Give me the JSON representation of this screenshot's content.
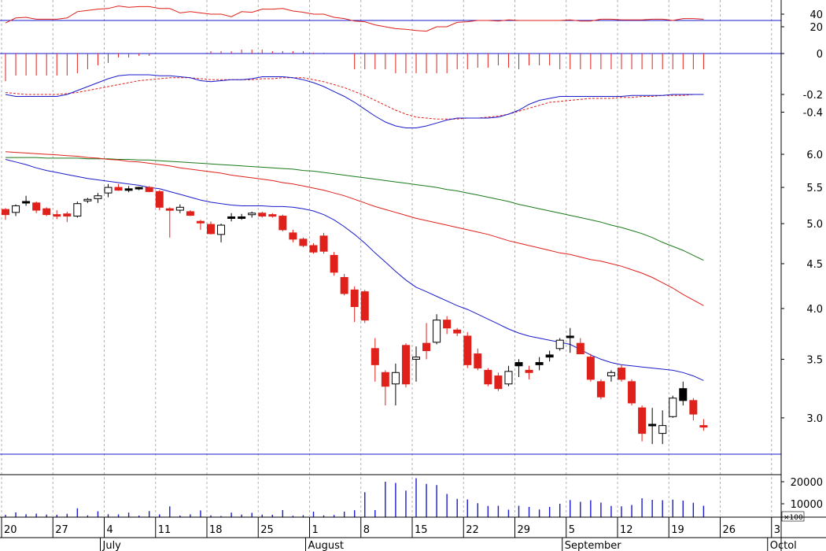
{
  "chart_data": {
    "type": "candlestick",
    "price_panel": {
      "y_axis": {
        "scale": "log",
        "range": [
          2.6,
          6.6
        ],
        "ticks": [
          "6.0",
          "5.5",
          "5.0",
          "4.5",
          "4.0",
          "3.5",
          "3.0"
        ]
      },
      "candles": [
        {
          "o": 5.12,
          "h": 5.21,
          "l": 5.05,
          "c": 5.19,
          "dir": "down"
        },
        {
          "o": 5.15,
          "h": 5.26,
          "l": 5.1,
          "c": 5.24,
          "dir": "up"
        },
        {
          "o": 5.3,
          "h": 5.38,
          "l": 5.24,
          "c": 5.28,
          "dir": "flat"
        },
        {
          "o": 5.28,
          "h": 5.3,
          "l": 5.14,
          "c": 5.18,
          "dir": "down"
        },
        {
          "o": 5.2,
          "h": 5.22,
          "l": 5.1,
          "c": 5.12,
          "dir": "down"
        },
        {
          "o": 5.12,
          "h": 5.18,
          "l": 5.06,
          "c": 5.11,
          "dir": "down"
        },
        {
          "o": 5.13,
          "h": 5.16,
          "l": 5.02,
          "c": 5.1,
          "dir": "down"
        },
        {
          "o": 5.1,
          "h": 5.3,
          "l": 5.08,
          "c": 5.27,
          "dir": "up"
        },
        {
          "o": 5.32,
          "h": 5.35,
          "l": 5.28,
          "c": 5.33,
          "dir": "up"
        },
        {
          "o": 5.34,
          "h": 5.42,
          "l": 5.28,
          "c": 5.38,
          "dir": "up"
        },
        {
          "o": 5.42,
          "h": 5.55,
          "l": 5.36,
          "c": 5.5,
          "dir": "up"
        },
        {
          "o": 5.5,
          "h": 5.55,
          "l": 5.45,
          "c": 5.46,
          "dir": "down"
        },
        {
          "o": 5.47,
          "h": 5.52,
          "l": 5.43,
          "c": 5.48,
          "dir": "flat"
        },
        {
          "o": 5.49,
          "h": 5.51,
          "l": 5.46,
          "c": 5.5,
          "dir": "flat"
        },
        {
          "o": 5.5,
          "h": 5.52,
          "l": 5.43,
          "c": 5.44,
          "dir": "down"
        },
        {
          "o": 5.44,
          "h": 5.46,
          "l": 5.18,
          "c": 5.22,
          "dir": "down"
        },
        {
          "o": 5.2,
          "h": 5.22,
          "l": 4.82,
          "c": 5.2,
          "dir": "down"
        },
        {
          "o": 5.18,
          "h": 5.26,
          "l": 5.14,
          "c": 5.22,
          "dir": "up"
        },
        {
          "o": 5.16,
          "h": 5.18,
          "l": 5.1,
          "c": 5.11,
          "dir": "down"
        },
        {
          "o": 5.02,
          "h": 5.05,
          "l": 4.92,
          "c": 5.03,
          "dir": "down"
        },
        {
          "o": 4.99,
          "h": 5.03,
          "l": 4.86,
          "c": 4.87,
          "dir": "down"
        },
        {
          "o": 4.86,
          "h": 5.0,
          "l": 4.76,
          "c": 4.98,
          "dir": "up"
        },
        {
          "o": 5.08,
          "h": 5.14,
          "l": 5.03,
          "c": 5.09,
          "dir": "flat"
        },
        {
          "o": 5.08,
          "h": 5.13,
          "l": 5.05,
          "c": 5.09,
          "dir": "flat"
        },
        {
          "o": 5.12,
          "h": 5.16,
          "l": 5.08,
          "c": 5.14,
          "dir": "up"
        },
        {
          "o": 5.14,
          "h": 5.16,
          "l": 5.08,
          "c": 5.1,
          "dir": "down"
        },
        {
          "o": 5.12,
          "h": 5.14,
          "l": 5.08,
          "c": 5.11,
          "dir": "down"
        },
        {
          "o": 5.1,
          "h": 5.12,
          "l": 4.9,
          "c": 4.92,
          "dir": "down"
        },
        {
          "o": 4.88,
          "h": 4.92,
          "l": 4.76,
          "c": 4.8,
          "dir": "down"
        },
        {
          "o": 4.8,
          "h": 4.82,
          "l": 4.7,
          "c": 4.72,
          "dir": "down"
        },
        {
          "o": 4.72,
          "h": 4.75,
          "l": 4.62,
          "c": 4.64,
          "dir": "down"
        },
        {
          "o": 4.84,
          "h": 4.88,
          "l": 4.62,
          "c": 4.65,
          "dir": "down"
        },
        {
          "o": 4.6,
          "h": 4.64,
          "l": 4.36,
          "c": 4.4,
          "dir": "down"
        },
        {
          "o": 4.34,
          "h": 4.38,
          "l": 4.14,
          "c": 4.16,
          "dir": "down"
        },
        {
          "o": 4.2,
          "h": 4.24,
          "l": 3.86,
          "c": 4.02,
          "dir": "down"
        },
        {
          "o": 4.18,
          "h": 4.2,
          "l": 3.85,
          "c": 3.88,
          "dir": "down"
        },
        {
          "o": 3.6,
          "h": 3.7,
          "l": 3.3,
          "c": 3.45,
          "dir": "down"
        },
        {
          "o": 3.38,
          "h": 3.4,
          "l": 3.1,
          "c": 3.26,
          "dir": "down"
        },
        {
          "o": 3.28,
          "h": 3.46,
          "l": 3.1,
          "c": 3.38,
          "dir": "up"
        },
        {
          "o": 3.63,
          "h": 3.65,
          "l": 3.25,
          "c": 3.28,
          "dir": "down"
        },
        {
          "o": 3.52,
          "h": 3.62,
          "l": 3.3,
          "c": 3.5,
          "dir": "up"
        },
        {
          "o": 3.65,
          "h": 3.85,
          "l": 3.5,
          "c": 3.58,
          "dir": "down"
        },
        {
          "o": 3.66,
          "h": 3.94,
          "l": 3.64,
          "c": 3.88,
          "dir": "up"
        },
        {
          "o": 3.88,
          "h": 3.92,
          "l": 3.74,
          "c": 3.8,
          "dir": "down"
        },
        {
          "o": 3.78,
          "h": 3.8,
          "l": 3.72,
          "c": 3.75,
          "dir": "down"
        },
        {
          "o": 3.72,
          "h": 3.76,
          "l": 3.42,
          "c": 3.45,
          "dir": "down"
        },
        {
          "o": 3.55,
          "h": 3.6,
          "l": 3.4,
          "c": 3.42,
          "dir": "down"
        },
        {
          "o": 3.4,
          "h": 3.42,
          "l": 3.26,
          "c": 3.28,
          "dir": "down"
        },
        {
          "o": 3.35,
          "h": 3.38,
          "l": 3.22,
          "c": 3.24,
          "dir": "down"
        },
        {
          "o": 3.28,
          "h": 3.44,
          "l": 3.26,
          "c": 3.39,
          "dir": "up"
        },
        {
          "o": 3.47,
          "h": 3.5,
          "l": 3.34,
          "c": 3.44,
          "dir": "flat"
        },
        {
          "o": 3.4,
          "h": 3.44,
          "l": 3.32,
          "c": 3.38,
          "dir": "down"
        },
        {
          "o": 3.45,
          "h": 3.52,
          "l": 3.4,
          "c": 3.47,
          "dir": "flat"
        },
        {
          "o": 3.52,
          "h": 3.58,
          "l": 3.48,
          "c": 3.54,
          "dir": "flat"
        },
        {
          "o": 3.6,
          "h": 3.7,
          "l": 3.58,
          "c": 3.68,
          "dir": "up"
        },
        {
          "o": 3.72,
          "h": 3.8,
          "l": 3.56,
          "c": 3.72,
          "dir": "flat"
        },
        {
          "o": 3.65,
          "h": 3.7,
          "l": 3.55,
          "c": 3.55,
          "dir": "down"
        },
        {
          "o": 3.52,
          "h": 3.55,
          "l": 3.3,
          "c": 3.32,
          "dir": "down"
        },
        {
          "o": 3.3,
          "h": 3.32,
          "l": 3.15,
          "c": 3.17,
          "dir": "down"
        },
        {
          "o": 3.35,
          "h": 3.4,
          "l": 3.3,
          "c": 3.38,
          "dir": "up"
        },
        {
          "o": 3.42,
          "h": 3.45,
          "l": 3.3,
          "c": 3.32,
          "dir": "down"
        },
        {
          "o": 3.3,
          "h": 3.32,
          "l": 3.1,
          "c": 3.12,
          "dir": "down"
        },
        {
          "o": 3.08,
          "h": 3.1,
          "l": 2.82,
          "c": 2.88,
          "dir": "down"
        },
        {
          "o": 2.95,
          "h": 3.08,
          "l": 2.8,
          "c": 2.94,
          "dir": "flat"
        },
        {
          "o": 2.88,
          "h": 3.06,
          "l": 2.8,
          "c": 2.94,
          "dir": "up"
        },
        {
          "o": 3.01,
          "h": 3.18,
          "l": 3.0,
          "c": 3.16,
          "dir": "up"
        },
        {
          "o": 3.14,
          "h": 3.3,
          "l": 3.1,
          "c": 3.24,
          "dir": "flat"
        },
        {
          "o": 3.14,
          "h": 3.16,
          "l": 2.98,
          "c": 3.03,
          "dir": "down"
        },
        {
          "o": 2.94,
          "h": 2.99,
          "l": 2.9,
          "c": 2.94,
          "dir": "down"
        }
      ],
      "ma_blue": [
        5.92,
        5.88,
        5.84,
        5.79,
        5.75,
        5.72,
        5.69,
        5.66,
        5.63,
        5.61,
        5.59,
        5.57,
        5.55,
        5.53,
        5.5,
        5.48,
        5.44,
        5.4,
        5.36,
        5.32,
        5.29,
        5.27,
        5.25,
        5.24,
        5.24,
        5.24,
        5.23,
        5.23,
        5.22,
        5.2,
        5.17,
        5.12,
        5.05,
        4.96,
        4.86,
        4.75,
        4.63,
        4.52,
        4.41,
        4.31,
        4.23,
        4.18,
        4.13,
        4.08,
        4.03,
        3.99,
        3.94,
        3.89,
        3.84,
        3.79,
        3.75,
        3.72,
        3.7,
        3.68,
        3.66,
        3.64,
        3.59,
        3.54,
        3.5,
        3.47,
        3.45,
        3.44,
        3.43,
        3.42,
        3.41,
        3.4,
        3.38,
        3.35,
        3.31
      ],
      "ma_red": [
        6.04,
        6.03,
        6.02,
        6.01,
        6.0,
        5.99,
        5.98,
        5.97,
        5.95,
        5.94,
        5.92,
        5.91,
        5.89,
        5.88,
        5.86,
        5.84,
        5.82,
        5.79,
        5.77,
        5.75,
        5.73,
        5.71,
        5.68,
        5.66,
        5.64,
        5.62,
        5.6,
        5.57,
        5.55,
        5.52,
        5.49,
        5.46,
        5.42,
        5.38,
        5.33,
        5.28,
        5.23,
        5.19,
        5.15,
        5.11,
        5.07,
        5.04,
        5.01,
        4.98,
        4.95,
        4.92,
        4.89,
        4.86,
        4.82,
        4.78,
        4.75,
        4.72,
        4.69,
        4.66,
        4.63,
        4.61,
        4.58,
        4.55,
        4.53,
        4.5,
        4.47,
        4.43,
        4.39,
        4.34,
        4.28,
        4.22,
        4.15,
        4.09,
        4.03
      ],
      "ma_green": [
        5.95,
        5.95,
        5.95,
        5.95,
        5.94,
        5.94,
        5.94,
        5.94,
        5.93,
        5.93,
        5.93,
        5.92,
        5.92,
        5.91,
        5.91,
        5.9,
        5.89,
        5.88,
        5.87,
        5.86,
        5.85,
        5.84,
        5.83,
        5.82,
        5.81,
        5.8,
        5.79,
        5.78,
        5.77,
        5.75,
        5.74,
        5.72,
        5.7,
        5.68,
        5.66,
        5.64,
        5.62,
        5.6,
        5.58,
        5.56,
        5.54,
        5.52,
        5.5,
        5.47,
        5.45,
        5.42,
        5.39,
        5.36,
        5.33,
        5.3,
        5.26,
        5.23,
        5.2,
        5.17,
        5.14,
        5.11,
        5.08,
        5.05,
        5.02,
        4.98,
        4.95,
        4.91,
        4.87,
        4.82,
        4.76,
        4.71,
        4.66,
        4.6,
        4.54
      ]
    },
    "rsi_panel": {
      "ticks": [
        "40",
        "20"
      ],
      "level": 30,
      "values": [
        26,
        34,
        35,
        32,
        32,
        32,
        34,
        44,
        46,
        48,
        49,
        53,
        51,
        52,
        52,
        49,
        49,
        42,
        44,
        42,
        40,
        40,
        36,
        44,
        43,
        48,
        48,
        49,
        45,
        43,
        40,
        40,
        35,
        33,
        29,
        28,
        23,
        20,
        17,
        16,
        14,
        13,
        20,
        20,
        27,
        28,
        30,
        30,
        29,
        31,
        30,
        30,
        30,
        30,
        30,
        31,
        29,
        29,
        32,
        32,
        31,
        31,
        31,
        32,
        32,
        30,
        33,
        33,
        32
      ]
    },
    "osc_panel": {
      "tick": "0",
      "values": [
        -35,
        -28,
        -28,
        -28,
        -28,
        -28,
        -28,
        -25,
        -20,
        -15,
        -12,
        -5,
        -5,
        -3,
        -3,
        0,
        0,
        0,
        0,
        0,
        3,
        3,
        3,
        5,
        5,
        5,
        3,
        3,
        3,
        3,
        1,
        1,
        0,
        0,
        -20,
        -20,
        -20,
        -20,
        -25,
        -25,
        -25,
        -25,
        -25,
        -25,
        -20,
        -20,
        -18,
        -18,
        -15,
        -18,
        -20,
        -15,
        -15,
        -15,
        -20,
        -20,
        -20,
        -20,
        -20,
        -20,
        -20,
        -20,
        -20,
        -20,
        -20,
        -20,
        -20,
        -20,
        -20
      ]
    },
    "macd_panel": {
      "ticks": [
        "-0.2",
        "-0.4"
      ],
      "macd": [
        -0.2,
        -0.22,
        -0.22,
        -0.22,
        -0.22,
        -0.22,
        -0.2,
        -0.16,
        -0.12,
        -0.08,
        -0.04,
        -0.01,
        0.0,
        0.0,
        0.0,
        -0.01,
        -0.01,
        -0.02,
        -0.03,
        -0.06,
        -0.07,
        -0.06,
        -0.05,
        -0.05,
        -0.04,
        -0.02,
        -0.02,
        -0.02,
        -0.03,
        -0.05,
        -0.08,
        -0.12,
        -0.17,
        -0.22,
        -0.28,
        -0.35,
        -0.42,
        -0.48,
        -0.52,
        -0.54,
        -0.54,
        -0.52,
        -0.49,
        -0.46,
        -0.44,
        -0.44,
        -0.44,
        -0.44,
        -0.43,
        -0.4,
        -0.36,
        -0.3,
        -0.26,
        -0.24,
        -0.22,
        -0.22,
        -0.22,
        -0.22,
        -0.22,
        -0.22,
        -0.22,
        -0.21,
        -0.21,
        -0.21,
        -0.21,
        -0.2,
        -0.2,
        -0.2,
        -0.2
      ],
      "signal": [
        -0.18,
        -0.19,
        -0.2,
        -0.2,
        -0.2,
        -0.2,
        -0.19,
        -0.18,
        -0.16,
        -0.14,
        -0.12,
        -0.1,
        -0.08,
        -0.06,
        -0.05,
        -0.04,
        -0.03,
        -0.03,
        -0.03,
        -0.04,
        -0.05,
        -0.05,
        -0.05,
        -0.05,
        -0.05,
        -0.04,
        -0.04,
        -0.03,
        -0.03,
        -0.03,
        -0.05,
        -0.07,
        -0.1,
        -0.13,
        -0.17,
        -0.21,
        -0.26,
        -0.31,
        -0.36,
        -0.4,
        -0.43,
        -0.44,
        -0.45,
        -0.45,
        -0.45,
        -0.44,
        -0.44,
        -0.43,
        -0.42,
        -0.4,
        -0.37,
        -0.34,
        -0.31,
        -0.28,
        -0.27,
        -0.26,
        -0.25,
        -0.24,
        -0.24,
        -0.24,
        -0.23,
        -0.23,
        -0.22,
        -0.22,
        -0.21,
        -0.21,
        -0.21,
        -0.2,
        -0.2
      ]
    },
    "volume_panel": {
      "ticks": [
        "20000",
        "10000"
      ],
      "unit": "x100",
      "values": [
        1200,
        2400,
        1500,
        1800,
        1300,
        1200,
        1700,
        4500,
        900,
        3000,
        1500,
        1400,
        2300,
        800,
        3100,
        1400,
        5500,
        800,
        1400,
        3400,
        900,
        600,
        2300,
        1300,
        2200,
        1300,
        1200,
        3600,
        700,
        1000,
        2800,
        900,
        1100,
        2800,
        3500,
        12700,
        3600,
        18000,
        17400,
        13500,
        19800,
        16900,
        16300,
        11800,
        9300,
        9000,
        7100,
        5700,
        5800,
        3800,
        5800,
        5200,
        3900,
        5200,
        6800,
        8700,
        7800,
        8600,
        7400,
        5700,
        5500,
        6200,
        9600,
        8800,
        8600,
        8900,
        8400,
        7300,
        5800
      ]
    },
    "x_axis": {
      "day_labels": [
        "20",
        "27",
        "4",
        "11",
        "18",
        "25",
        "1",
        "8",
        "15",
        "22",
        "29",
        "5",
        "12",
        "19",
        "26",
        "3"
      ],
      "month_labels": [
        "July",
        "August",
        "September",
        "Octol"
      ]
    }
  }
}
